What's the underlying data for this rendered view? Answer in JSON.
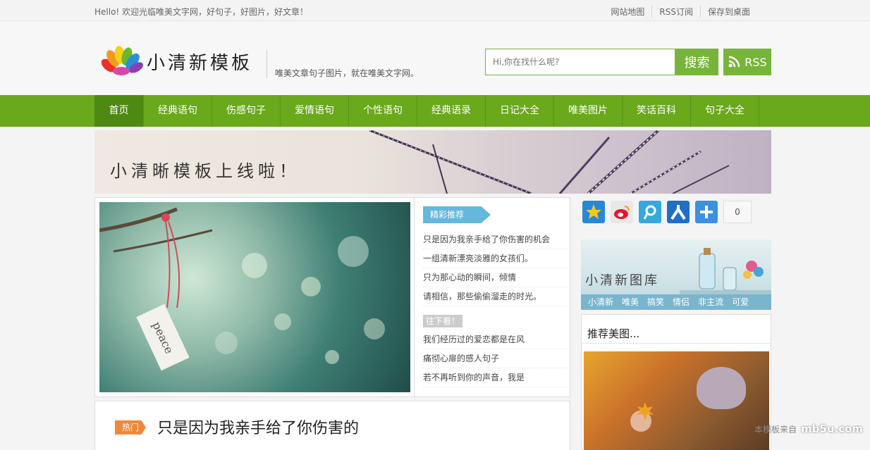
{
  "topbar": {
    "welcome": "Hello! 欢迎光临唯美文字网，好句子，好图片，好文章！",
    "links": [
      "网站地图",
      "RSS订阅",
      "保存到桌面"
    ]
  },
  "header": {
    "logo_text": "小清新模板",
    "slogan": "唯美文章句子图片，就在唯美文字网。",
    "search_placeholder": "Hi,你在找什么呢?",
    "search_button": "搜索",
    "rss_label": "RSS"
  },
  "nav": {
    "items": [
      "首页",
      "经典语句",
      "伤感句子",
      "爱情语句",
      "个性语句",
      "经典语录",
      "日记大全",
      "唯美图片",
      "笑话百科",
      "句子大全"
    ]
  },
  "banner": {
    "text": "小清晰模板上线啦！"
  },
  "main": {
    "photo_tag": "peace",
    "recommend_label": "精彩推荐",
    "recommend_items": [
      "只是因为我亲手给了你伤害的机会",
      "一组清新漂亮淡雅的女孩们。",
      "只为那心动的瞬间，倾情",
      "请相信，那些偷偷溜走的时光。"
    ],
    "more_label": "往下看！",
    "more_items": [
      "我们经历过的爱恋都是在风",
      "痛彻心扉的感人句子",
      "若不再听到你的声音，我是"
    ]
  },
  "hot": {
    "tag": "热门",
    "title": "只是因为我亲手给了你伤害的"
  },
  "sidebar": {
    "share_count": "0",
    "gallery_title": "小清新图库",
    "gallery_tags": [
      "小清新",
      "唯美",
      "搞笑",
      "情侣",
      "非主流",
      "可爱"
    ],
    "recommend_title": "推荐美图..."
  },
  "watermark": {
    "prefix": "本模板来自",
    "brand": "mb5u.com"
  },
  "colors": {
    "accent": "#6aa81c",
    "accent_dark": "#4e8a12",
    "ribbon_blue": "#66b7dc",
    "hot_orange": "#f0883a"
  }
}
